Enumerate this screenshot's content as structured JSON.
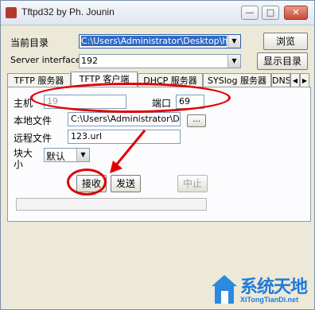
{
  "window": {
    "title": "Tftpd32 by Ph. Jounin",
    "minimize": "—",
    "maximize": "□",
    "close": "✕"
  },
  "top": {
    "current_dir_label": "当前目录",
    "current_dir_value": "C:\\Users\\Administrator\\Desktop\\ha_T",
    "browse_button": "浏览",
    "server_interface_label": "Server interface",
    "server_interface_value": "192",
    "show_dir_button": "显示目录"
  },
  "tabs": [
    {
      "label": "TFTP 服务器"
    },
    {
      "label": "TFTP 客户端"
    },
    {
      "label": "DHCP 服务器"
    },
    {
      "label": "SYSlog 服务器"
    },
    {
      "label": "DNS"
    }
  ],
  "client": {
    "host_label": "主机",
    "host_value": "19",
    "port_label": "端口",
    "port_value": "69",
    "local_file_label": "本地文件",
    "local_file_value": "C:\\Users\\Administrator\\Desk",
    "local_file_browse": "...",
    "remote_file_label": "远程文件",
    "remote_file_value": "123.url",
    "block_size_label_1": "块大",
    "block_size_label_2": "小",
    "block_size_value": "默认",
    "receive_button": "接收",
    "send_button": "发送",
    "abort_button": "中止"
  },
  "watermark": {
    "text": "系统天地",
    "sub": "XiTongTianDi.net"
  },
  "colors": {
    "annotation_red": "#e00000",
    "brand_blue": "#1f7ad9"
  }
}
